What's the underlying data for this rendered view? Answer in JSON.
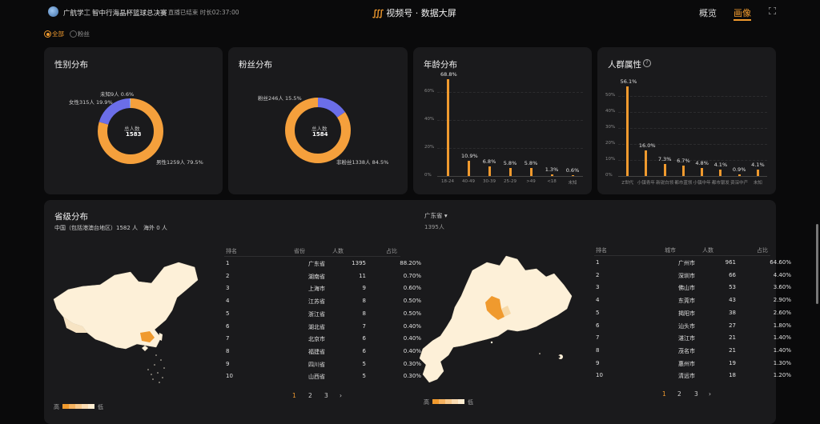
{
  "header": {
    "brand": "广航学工",
    "match": "智中行海晶杯篮球总决赛",
    "live_status": "◉ 直播已结束 时长02:37:00",
    "center_mark": "∭",
    "center_title": "视频号 · 数据大屏",
    "tabs": [
      "概览",
      "画像"
    ],
    "active_tab": "画像",
    "fullscreen_icon": "fullscreen-icon"
  },
  "filters": {
    "options": [
      "全部",
      "粉丝"
    ],
    "selected": "全部"
  },
  "gender": {
    "title": "性别分布",
    "center_label": "总人数",
    "center_value": "1583",
    "labels": [
      "未知9人 0.6%",
      "女性315人 19.9%",
      "男性1259人 79.5%"
    ],
    "slices": [
      {
        "name": "男性",
        "value": 1259,
        "color": "#f5a03c"
      },
      {
        "name": "女性",
        "value": 315,
        "color": "#6b6ee8"
      },
      {
        "name": "未知",
        "value": 9,
        "color": "#9ab8f0"
      }
    ]
  },
  "fans": {
    "title": "粉丝分布",
    "center_label": "总人数",
    "center_value": "1584",
    "labels": [
      "粉丝246人 15.5%",
      "非粉丝1338人 84.5%"
    ],
    "slices": [
      {
        "name": "非粉丝",
        "value": 1338,
        "color": "#f5a03c"
      },
      {
        "name": "粉丝",
        "value": 246,
        "color": "#6b6ee8"
      }
    ]
  },
  "age": {
    "title": "年龄分布",
    "yticks": [
      "60%",
      "40%",
      "20%",
      "0%"
    ],
    "categories": [
      "18-24",
      "40-49",
      "30-39",
      "25-29",
      ">49",
      "<18",
      "未知"
    ],
    "values": [
      68.8,
      10.9,
      6.8,
      5.8,
      5.8,
      1.3,
      0.6
    ],
    "value_labels": [
      "68.8%",
      "10.9%",
      "6.8%",
      "5.8%",
      "5.8%",
      "1.3%",
      "0.6%"
    ]
  },
  "crowd": {
    "title": "人群属性",
    "help_icon": "help-circle-icon",
    "yticks": [
      "50%",
      "40%",
      "30%",
      "20%",
      "10%",
      "0%"
    ],
    "categories": [
      "Z世代",
      "小镇青年",
      "新锐白领",
      "都市蓝领",
      "小镇中年",
      "都市银发",
      "资深中产",
      "未知"
    ],
    "values": [
      56.1,
      16.0,
      7.3,
      6.7,
      4.8,
      4.1,
      0.9,
      4.1
    ],
    "value_labels": [
      "56.1%",
      "16.0%",
      "7.3%",
      "6.7%",
      "4.8%",
      "4.1%",
      "0.9%",
      "4.1%"
    ]
  },
  "province": {
    "title": "省级分布",
    "summary": "中国（包括港澳台地区）1582 人",
    "overseas": "海外 0 人",
    "headers": [
      "排名",
      "省份",
      "人数",
      "占比"
    ],
    "rows": [
      [
        "1",
        "广东省",
        "1395",
        "88.20%"
      ],
      [
        "2",
        "湖南省",
        "11",
        "0.70%"
      ],
      [
        "3",
        "上海市",
        "9",
        "0.60%"
      ],
      [
        "4",
        "江苏省",
        "8",
        "0.50%"
      ],
      [
        "5",
        "浙江省",
        "8",
        "0.50%"
      ],
      [
        "6",
        "湖北省",
        "7",
        "0.40%"
      ],
      [
        "7",
        "北京市",
        "6",
        "0.40%"
      ],
      [
        "8",
        "福建省",
        "6",
        "0.40%"
      ],
      [
        "9",
        "四川省",
        "5",
        "0.30%"
      ],
      [
        "10",
        "山西省",
        "5",
        "0.30%"
      ]
    ],
    "pages": [
      "1",
      "2",
      "3",
      "›"
    ],
    "active_page": "1",
    "legend_high": "高",
    "legend_low": "低"
  },
  "city": {
    "selector": "广东省 ▾",
    "total": "1395人",
    "headers": [
      "排名",
      "城市",
      "人数",
      "占比"
    ],
    "rows": [
      [
        "1",
        "广州市",
        "961",
        "64.60%"
      ],
      [
        "2",
        "深圳市",
        "66",
        "4.40%"
      ],
      [
        "3",
        "佛山市",
        "53",
        "3.60%"
      ],
      [
        "4",
        "东莞市",
        "43",
        "2.90%"
      ],
      [
        "5",
        "揭阳市",
        "38",
        "2.60%"
      ],
      [
        "6",
        "汕头市",
        "27",
        "1.80%"
      ],
      [
        "7",
        "湛江市",
        "21",
        "1.40%"
      ],
      [
        "8",
        "茂名市",
        "21",
        "1.40%"
      ],
      [
        "9",
        "惠州市",
        "19",
        "1.30%"
      ],
      [
        "10",
        "清远市",
        "18",
        "1.20%"
      ]
    ],
    "pages": [
      "1",
      "2",
      "3",
      "›"
    ],
    "active_page": "1",
    "legend_high": "高",
    "legend_low": "低"
  },
  "colors": {
    "accent": "#f09a2e",
    "female": "#6b6ee8",
    "map_light": "#fdf0d8",
    "card": "#1a1a1c"
  }
}
